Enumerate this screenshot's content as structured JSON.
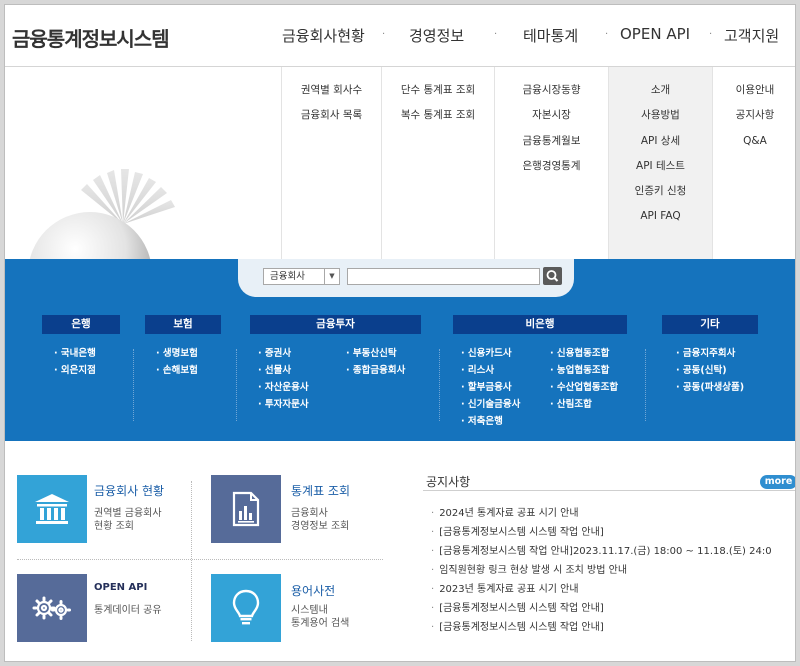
{
  "header": {
    "logo": "금융통계정보시스템",
    "nav": [
      "금융회사현황",
      "경영정보",
      "테마통계",
      "OPEN API",
      "고객지원"
    ]
  },
  "mega_menu": {
    "col1": [
      "권역별 회사수",
      "금융회사 목록"
    ],
    "col2": [
      "단수 통계표 조회",
      "복수 통계표 조회"
    ],
    "col3": [
      "금융시장동향",
      "자본시장",
      "금융통계월보",
      "은행경영통계"
    ],
    "col4": [
      "소개",
      "사용방법",
      "API 상세",
      "API 테스트",
      "인증키 신청",
      "API FAQ"
    ],
    "col5": [
      "이용안내",
      "공지사항",
      "Q&A"
    ]
  },
  "search": {
    "select_value": "금융회사"
  },
  "categories": {
    "bank": {
      "title": "은행",
      "links": [
        "국내은행",
        "외은지점"
      ]
    },
    "insurance": {
      "title": "보험",
      "links": [
        "생명보험",
        "손해보험"
      ]
    },
    "invest": {
      "title": "금융투자",
      "links_left": [
        "증권사",
        "선물사",
        "자산운용사",
        "투자자문사"
      ],
      "links_right": [
        "부동산신탁",
        "종합금융회사"
      ]
    },
    "nonbank": {
      "title": "비은행",
      "links_left": [
        "신용카드사",
        "리스사",
        "할부금융사",
        "신기술금융사",
        "저축은행"
      ],
      "links_right": [
        "신용협동조합",
        "농업협동조합",
        "수산업협동조합",
        "산림조합"
      ]
    },
    "etc": {
      "title": "기타",
      "links": [
        "금융지주회사",
        "공동(신탁)",
        "공동(파생상품)"
      ]
    }
  },
  "quick": [
    {
      "title": "금융회사 현황",
      "desc": [
        "권역별 금융회사",
        "현황 조회"
      ]
    },
    {
      "title": "통계표 조회",
      "desc": [
        "금융회사",
        "경영정보 조회"
      ]
    },
    {
      "title": "OPEN API",
      "desc": [
        "통계데이터 공유"
      ]
    },
    {
      "title": "용어사전",
      "desc": [
        "시스템내",
        "통계용어 검색"
      ]
    }
  ],
  "notice": {
    "title": "공지사항",
    "more": "more +",
    "items": [
      "2024년 통계자료 공표 시기 안내",
      "[금융통계정보시스템 시스템 작업 안내]",
      "[금융통계정보시스템 작업 안내]2023.11.17.(금) 18:00 ~ 11.18.(토) 24:0",
      "임직원현황 링크 현상 발생 시 조치 방법 안내",
      "2023년 통계자료 공표 시기 안내",
      "[금융통계정보시스템 시스템 작업 안내]",
      "[금융통계정보시스템 시스템 작업 안내]"
    ]
  },
  "colors": {
    "band": "#1573bd",
    "category_header": "#0a3f8d",
    "quick_cyan": "#33a3d7",
    "quick_navy": "#566b99"
  }
}
